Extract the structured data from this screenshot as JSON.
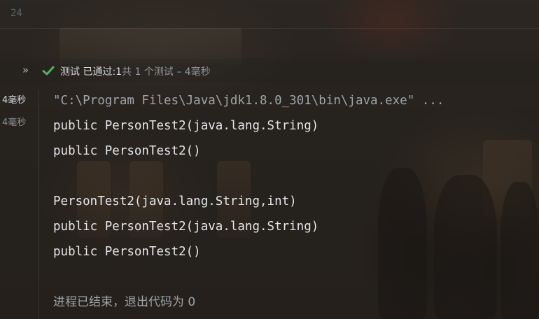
{
  "editor": {
    "line_number": "24"
  },
  "test_status": {
    "label": "测试",
    "passed_prefix": "已通过:",
    "passed_count": "1",
    "summary": "共 1 个测试 – 4毫秒"
  },
  "test_tree": {
    "items": [
      {
        "duration": "4毫秒"
      },
      {
        "duration": "4毫秒"
      }
    ]
  },
  "console": {
    "lines": [
      "\"C:\\Program Files\\Java\\jdk1.8.0_301\\bin\\java.exe\" ...",
      "public PersonTest2(java.lang.String)",
      "public PersonTest2()",
      "",
      "PersonTest2(java.lang.String,int)",
      "public PersonTest2(java.lang.String)",
      "public PersonTest2()",
      "",
      "进程已结束，退出代码为 0"
    ]
  },
  "colors": {
    "passed_green": "#4fb35a",
    "text": "#e4e6e9",
    "muted": "#9ea4aa"
  }
}
